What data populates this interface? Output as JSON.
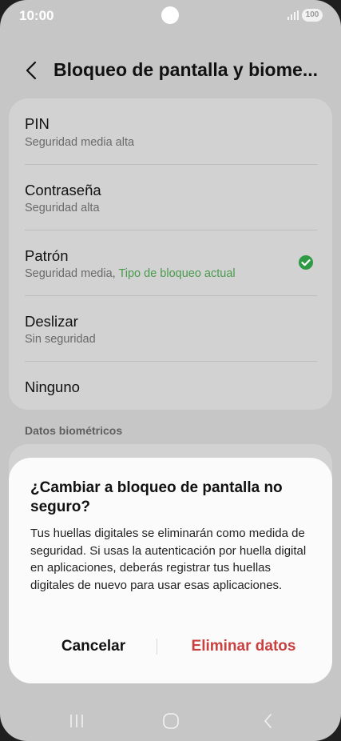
{
  "status_bar": {
    "time": "10:00",
    "battery": "100",
    "icons": [
      "camera-cutout",
      "signal-icon",
      "battery-icon"
    ]
  },
  "header": {
    "back_icon": "chevron-left-icon",
    "title": "Bloqueo de pantalla y biome..."
  },
  "lock_options": [
    {
      "label": "PIN",
      "description": "Seguridad media alta"
    },
    {
      "label": "Contraseña",
      "description": "Seguridad alta"
    },
    {
      "label": "Patrón",
      "description": "Seguridad media, ",
      "current_note": "Tipo de bloqueo actual",
      "selected": true
    },
    {
      "label": "Deslizar",
      "description": "Sin seguridad"
    },
    {
      "label": "Ninguno",
      "description": ""
    }
  ],
  "biometrics_section": {
    "label": "Datos biométricos"
  },
  "dialog": {
    "title": "¿Cambiar a bloqueo de pantalla no seguro?",
    "body": "Tus huellas digitales se eliminarán como medida de seguridad. Si usas la autenticación por huella digital en aplicaciones, deberás registrar tus huellas digitales de nuevo para usar esas aplicaciones.",
    "cancel_label": "Cancelar",
    "confirm_label": "Eliminar datos"
  },
  "nav_bar": {
    "icons": [
      "recent-apps-icon",
      "home-icon",
      "back-icon"
    ]
  },
  "colors": {
    "background": "#c6c6c6",
    "card": "#d2d2d2",
    "dialog": "#fbfbfb",
    "accent_green": "#4a9a4e",
    "destructive_red": "#c94040"
  }
}
